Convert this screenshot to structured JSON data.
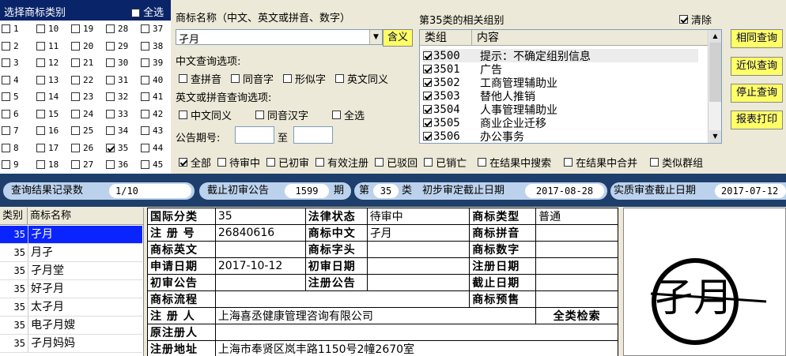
{
  "class_panel": {
    "title": "选择商标类别",
    "select_all": "全选",
    "classes": [
      {
        "n": "1",
        "on": false
      },
      {
        "n": "2",
        "on": false
      },
      {
        "n": "3",
        "on": false
      },
      {
        "n": "4",
        "on": false
      },
      {
        "n": "5",
        "on": false
      },
      {
        "n": "6",
        "on": false
      },
      {
        "n": "7",
        "on": false
      },
      {
        "n": "8",
        "on": false
      },
      {
        "n": "9",
        "on": false
      },
      {
        "n": "10",
        "on": false
      },
      {
        "n": "11",
        "on": false
      },
      {
        "n": "12",
        "on": false
      },
      {
        "n": "13",
        "on": false
      },
      {
        "n": "14",
        "on": false
      },
      {
        "n": "15",
        "on": false
      },
      {
        "n": "16",
        "on": false
      },
      {
        "n": "17",
        "on": false
      },
      {
        "n": "18",
        "on": false
      },
      {
        "n": "19",
        "on": false
      },
      {
        "n": "20",
        "on": false
      },
      {
        "n": "21",
        "on": false
      },
      {
        "n": "22",
        "on": false
      },
      {
        "n": "23",
        "on": false
      },
      {
        "n": "24",
        "on": false
      },
      {
        "n": "25",
        "on": false
      },
      {
        "n": "26",
        "on": false
      },
      {
        "n": "27",
        "on": false
      },
      {
        "n": "28",
        "on": false
      },
      {
        "n": "29",
        "on": false
      },
      {
        "n": "30",
        "on": false
      },
      {
        "n": "31",
        "on": false
      },
      {
        "n": "32",
        "on": false
      },
      {
        "n": "33",
        "on": false
      },
      {
        "n": "34",
        "on": false
      },
      {
        "n": "35",
        "on": true
      },
      {
        "n": "36",
        "on": false
      },
      {
        "n": "37",
        "on": false
      },
      {
        "n": "38",
        "on": false
      },
      {
        "n": "39",
        "on": false
      },
      {
        "n": "40",
        "on": false
      },
      {
        "n": "41",
        "on": false
      },
      {
        "n": "42",
        "on": false
      },
      {
        "n": "43",
        "on": false
      },
      {
        "n": "44",
        "on": false
      },
      {
        "n": "45",
        "on": false
      }
    ]
  },
  "search": {
    "name_label": "商标名称（中文、英文或拼音、数字）",
    "name_value": "孑月",
    "meaning_button": "含义",
    "cn_options_label": "中文查询选项:",
    "cn_options": [
      "查拼音",
      "同音字",
      "形似字",
      "英文同义"
    ],
    "en_options_label": "英文或拼音查询选项:",
    "en_options": [
      "中文同义",
      "同音汉字",
      "全选"
    ],
    "issue_label": "公告期号:",
    "issue_to": "至"
  },
  "groups": {
    "title": "第35类的相关组别",
    "clear_label": "清除",
    "col_group": "类组",
    "col_content": "内容",
    "rows": [
      {
        "code": "3500",
        "text": "提示：不确定组别信息"
      },
      {
        "code": "3501",
        "text": "广告"
      },
      {
        "code": "3502",
        "text": "工商管理辅助业"
      },
      {
        "code": "3503",
        "text": "替他人推销"
      },
      {
        "code": "3504",
        "text": "人事管理辅助业"
      },
      {
        "code": "3505",
        "text": "商业企业迁移"
      },
      {
        "code": "3506",
        "text": "办公事务"
      }
    ]
  },
  "actions": {
    "same_query": "相同查询",
    "similar_query": "近似查询",
    "stop_query": "停止查询",
    "print_report": "报表打印"
  },
  "filters": {
    "items": [
      {
        "label": "全部",
        "on": true
      },
      {
        "label": "待审中",
        "on": false
      },
      {
        "label": "已初审",
        "on": false
      },
      {
        "label": "有效注册",
        "on": false
      },
      {
        "label": "已驳回",
        "on": false
      },
      {
        "label": "已销亡",
        "on": false
      },
      {
        "label": "在结果中搜索",
        "on": false
      },
      {
        "label": "在结果中合并",
        "on": false
      },
      {
        "label": "类似群组",
        "on": false
      }
    ]
  },
  "stats": {
    "records_label": "查询结果记录数",
    "records_value": "1/10",
    "cutoff_label": "截止初审公告",
    "cutoff_value": "1599",
    "cutoff_unit": "期",
    "class_prefix": "第",
    "class_value": "35",
    "class_suffix": "类",
    "prelim_label": "初步审定截止日期",
    "prelim_value": "2017-08-28",
    "exam_label": "实质审查截止日期",
    "exam_value": "2017-07-12"
  },
  "results": {
    "col_class": "类别",
    "col_name": "商标名称",
    "rows": [
      {
        "cls": "35",
        "name": "孑月",
        "selected": true
      },
      {
        "cls": "35",
        "name": "月孑",
        "selected": false
      },
      {
        "cls": "35",
        "name": "孑月堂",
        "selected": false
      },
      {
        "cls": "35",
        "name": "好孑月",
        "selected": false
      },
      {
        "cls": "35",
        "name": "太孑月",
        "selected": false
      },
      {
        "cls": "35",
        "name": "电孑月嫂",
        "selected": false
      },
      {
        "cls": "35",
        "name": "孑月妈妈",
        "selected": false
      }
    ]
  },
  "detail": {
    "intl_class_k": "国际分类",
    "intl_class_v": "35",
    "legal_status_k": "法律状态",
    "legal_status_v": "待审中",
    "tm_type_k": "商标类型",
    "tm_type_v": "普通",
    "reg_no_k": "注 册 号",
    "reg_no_v": "26840616",
    "tm_cn_k": "商标中文",
    "tm_cn_v": "孑月",
    "tm_pinyin_k": "商标拼音",
    "tm_pinyin_v": "",
    "tm_en_k": "商标英文",
    "tm_en_v": "",
    "tm_initial_k": "商标字头",
    "tm_initial_v": "",
    "tm_digits_k": "商标数字",
    "tm_digits_v": "",
    "apply_date_k": "申请日期",
    "apply_date_v": "2017-10-12",
    "prelim_date_k": "初审日期",
    "prelim_date_v": "",
    "reg_date_k": "注册日期",
    "reg_date_v": "",
    "prelim_notice_k": "初审公告",
    "prelim_notice_v": "",
    "reg_notice_k": "注册公告",
    "reg_notice_v": "",
    "expiry_date_k": "截止日期",
    "expiry_date_v": "",
    "process_k": "商标流程",
    "process_v": "",
    "warning_k": "商标预售",
    "warning_v": "",
    "registrant_k": "注 册 人",
    "registrant_v": "上海喜丞健康管理咨询有限公司",
    "all_class_search": "全类检索",
    "orig_registrant_k": "原注册人",
    "orig_registrant_v": "",
    "reg_address_k": "注册地址",
    "reg_address_v": "上海市奉贤区岚丰路1150号2幢2670室"
  },
  "logo": {
    "text": "孑月"
  }
}
